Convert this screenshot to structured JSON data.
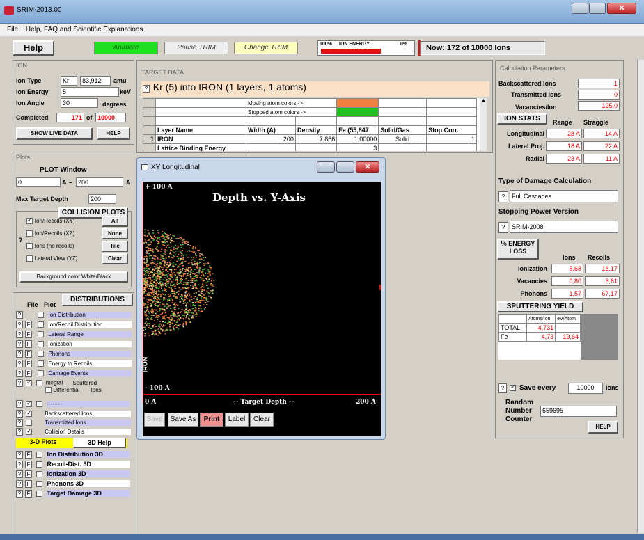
{
  "window": {
    "title": "SRIM-2013.00"
  },
  "menu": {
    "items": [
      "File",
      "Help, FAQ and Scientific Explanations"
    ]
  },
  "toolbar": {
    "help": "Help",
    "animate": "Animate",
    "pause": "Pause TRIM",
    "change": "Change TRIM",
    "energy_left": "100%",
    "energy_label": "ION ENERGY",
    "energy_right": "0%",
    "energy_fraction": 0.65,
    "status": "Now: 172 of 10000 Ions"
  },
  "ion": {
    "header": "ION",
    "type_label": "Ion Type",
    "type": "Kr",
    "mass": "83,912",
    "mass_unit": "amu",
    "energy_label": "Ion Energy",
    "energy": "5",
    "energy_unit": "keV",
    "angle_label": "Ion Angle",
    "angle": "30",
    "angle_unit": "degrees",
    "completed_label": "Completed",
    "completed": "171",
    "of_label": "of",
    "total": "10000",
    "show_live": "SHOW LIVE DATA",
    "help": "HELP"
  },
  "plots": {
    "header": "Plots",
    "window_title": "PLOT  Window",
    "min": "0",
    "unit1": "A",
    "dash": "–",
    "max": "200",
    "unit2": "A",
    "max_depth_label": "Max Target Depth",
    "max_depth": "200",
    "collision_title": "COLLISION PLOTS",
    "q": "?",
    "collision_items": [
      {
        "label": "Ion/Recoils (XY)",
        "checked": true,
        "btn": "All"
      },
      {
        "label": "Ion/Recoils (XZ)",
        "checked": false,
        "btn": "None"
      },
      {
        "label": "Ions (no recoils)",
        "checked": false,
        "btn": "Tile"
      },
      {
        "label": "Lateral View (YZ)",
        "checked": false,
        "btn": "Clear"
      }
    ],
    "bg_color": "Background color White/Black"
  },
  "dist": {
    "title": "DISTRIBUTIONS",
    "file": "File",
    "plot": "Plot",
    "q": "?",
    "f": "F",
    "items": [
      "Ion Distribution",
      "Ion/Recoil Distribution",
      "Lateral Range",
      "Ionization",
      "Phonons",
      "Energy to Recoils",
      "Damage Events"
    ],
    "integral": "Integral",
    "differential": "Differential",
    "sputtered": "Sputtered",
    "ions": "Ions",
    "dashes": "--------",
    "extra": [
      "Backscattered Ions",
      "Transmitted Ions",
      "Collision Details"
    ],
    "plots3d_label": "3-D Plots",
    "help3d": "3D Help",
    "items3d": [
      "Ion Distribution 3D",
      "Recoil-Dist. 3D",
      "Ionization 3D",
      "Phonons 3D",
      "Target Damage 3D"
    ]
  },
  "target": {
    "header": "TARGET DATA",
    "q": "?",
    "title": "Kr (5) into IRON (1 layers, 1 atoms)",
    "moving": "Moving atom colors ->",
    "stopped": "Stopped atom colors ->",
    "moving_color": "#f08040",
    "stopped_color": "#20c020",
    "cols": [
      "Layer Name",
      "Width (A)",
      "Density",
      "Fe (55,847",
      "Solid/Gas",
      "Stop Corr."
    ],
    "row": {
      "num": "1",
      "name": "IRON",
      "width": "200",
      "density": "7,866",
      "fe": "1,00000",
      "phase": "Solid",
      "corr": "1"
    },
    "next_row": "Lattice Binding Energy",
    "next_val": "3"
  },
  "plotwin": {
    "title": "XY Longitudinal",
    "top_label": "+ 100 A",
    "chart_title": "Depth vs. Y-Axis",
    "axis_label": "IRON",
    "bottom_label": "- 100 A",
    "x0": "0 A",
    "xlabel": "-- Target Depth --",
    "x1": "200 A",
    "btns": [
      "Save",
      "Save As",
      "Print",
      "Label",
      "Clear"
    ]
  },
  "calc": {
    "header": "Calculation Parameters",
    "backscat_label": "Backscattered Ions",
    "backscat": "1",
    "trans_label": "Transmitted Ions",
    "trans": "0",
    "vac_label": "Vacancies/Ion",
    "vac": "125,0",
    "stats_title": "ION STATS",
    "range": "Range",
    "straggle": "Straggle",
    "stats": [
      {
        "label": "Longitudinal",
        "range": "28 A",
        "straggle": "14 A"
      },
      {
        "label": "Lateral Proj.",
        "range": "18 A",
        "straggle": "22 A"
      },
      {
        "label": "Radial",
        "range": "23 A",
        "straggle": "11 A"
      }
    ],
    "damage_label": "Type of Damage Calculation",
    "q": "?",
    "damage": "Full Cascades",
    "stopping_label": "Stopping Power Version",
    "stopping": "SRIM-2008",
    "eloss_title": "% ENERGY LOSS",
    "ions": "Ions",
    "recoils": "Recoils",
    "eloss": [
      {
        "label": "Ionization",
        "ions": "5,68",
        "recoils": "18,17"
      },
      {
        "label": "Vacancies",
        "ions": "0,80",
        "recoils": "6,61"
      },
      {
        "label": "Phonons",
        "ions": "1,57",
        "recoils": "67,17"
      }
    ],
    "sputter_title": "SPUTTERING YIELD",
    "atoms_ion": "Atoms/Ion",
    "ev_atom": "eV/Atom",
    "sputter": [
      {
        "label": "TOTAL",
        "atoms": "4,731",
        "ev": ""
      },
      {
        "label": "Fe",
        "atoms": "4,73",
        "ev": "19,64"
      }
    ],
    "save_label": "Save every",
    "save_val": "10000",
    "save_unit": "ions",
    "random_label1": "Random",
    "random_label2": "Number",
    "random_label3": "Counter",
    "random": "659695",
    "help": "HELP"
  }
}
